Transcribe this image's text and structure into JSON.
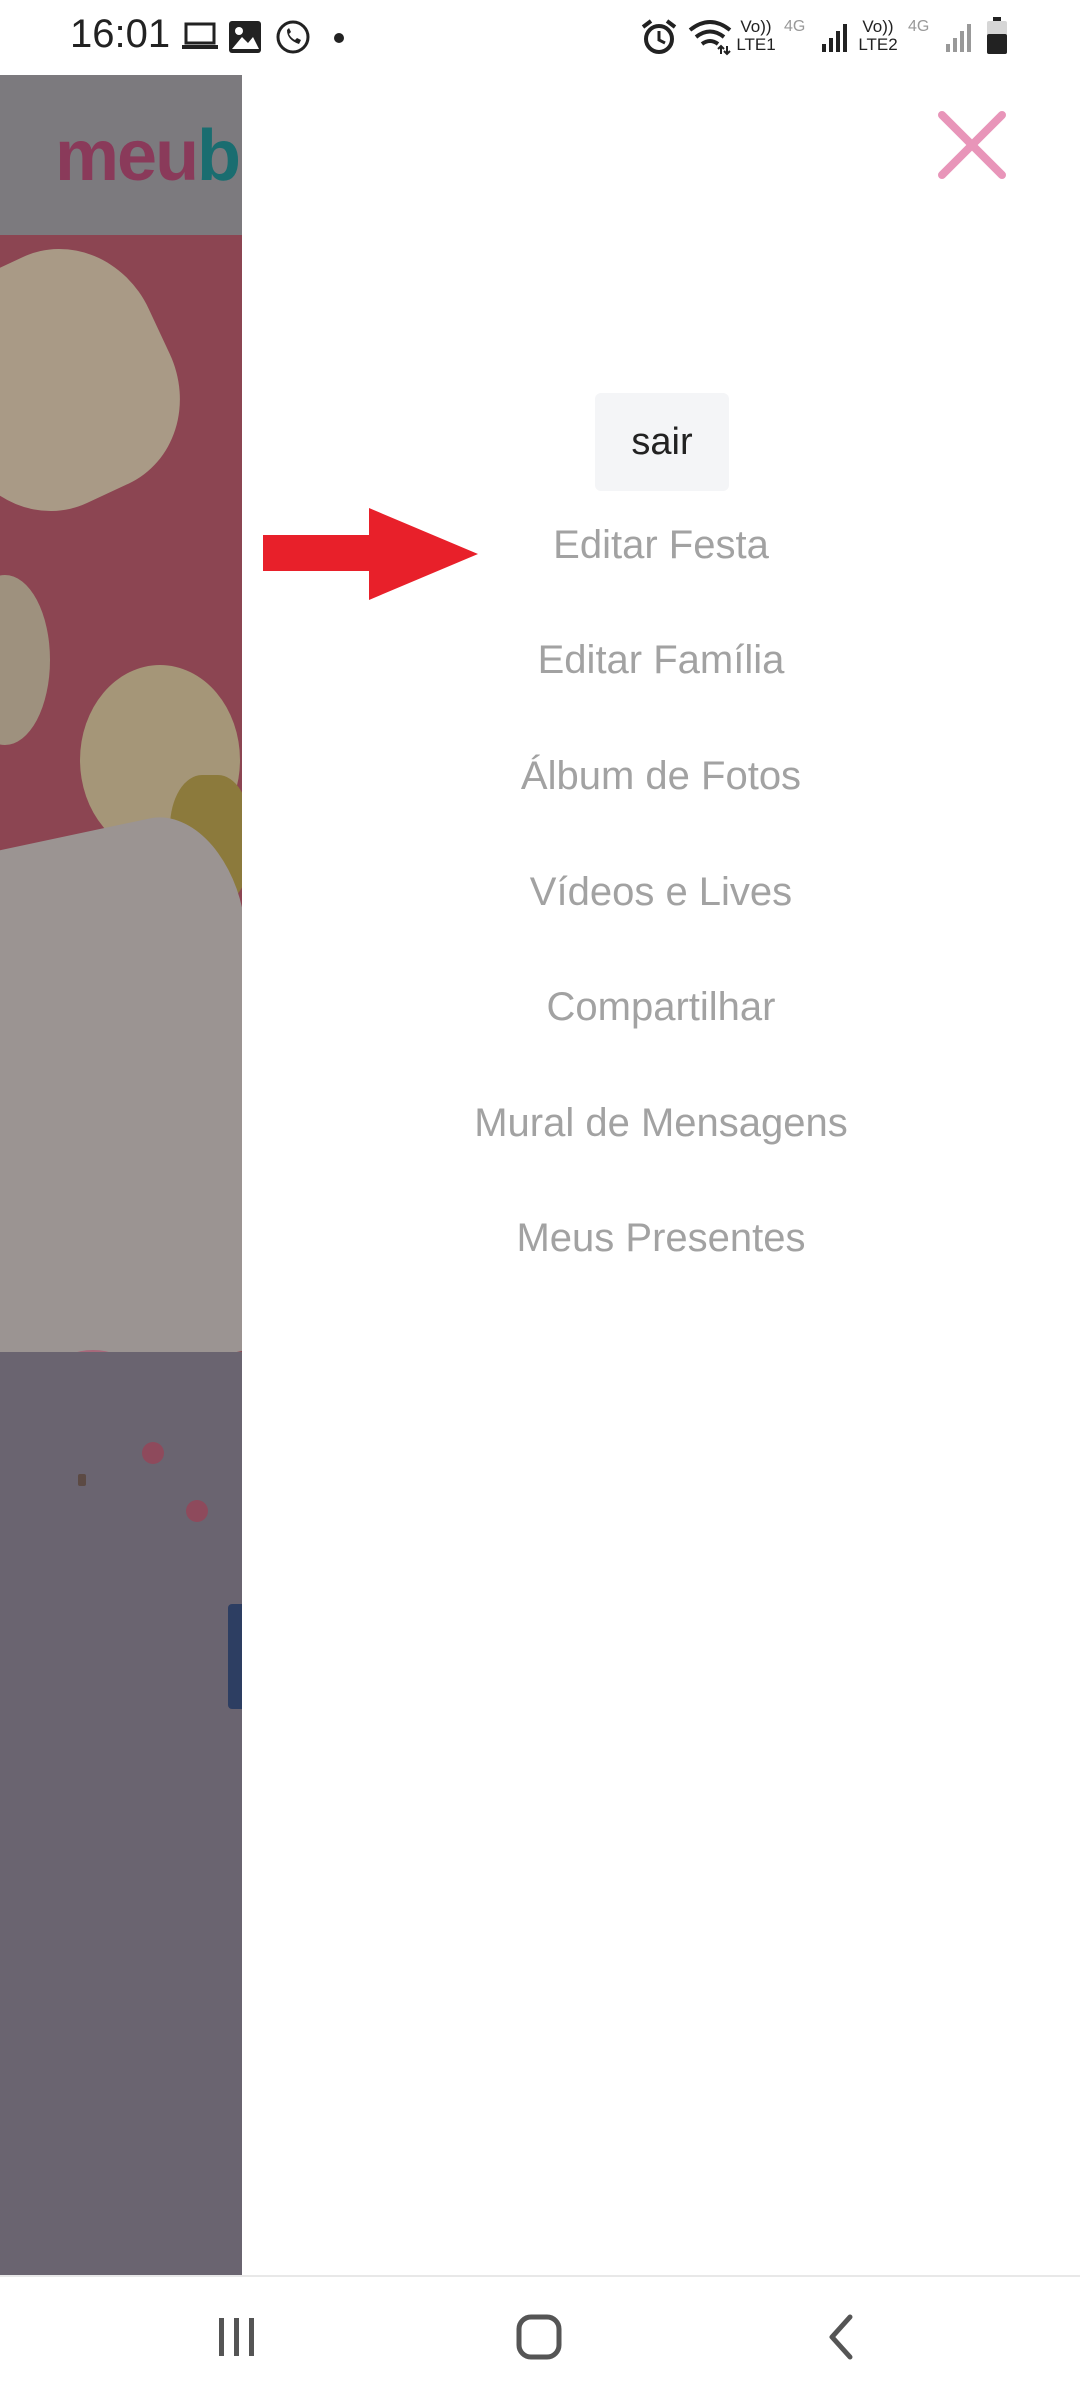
{
  "status_bar": {
    "time": "16:01",
    "left_icons": [
      "laptop-icon",
      "image-icon",
      "whatsapp-icon",
      "dot-icon"
    ],
    "lte1_top": "Vo))",
    "lte1_bottom": "LTE1",
    "sim1_type": "4G",
    "lte2_top": "Vo))",
    "lte2_bottom": "LTE2",
    "sim2_type": "4G"
  },
  "background_app": {
    "logo_part1": "meu",
    "logo_part2": "b"
  },
  "drawer": {
    "close_icon": "close-icon",
    "close_color": "#e895b9",
    "logout_label": "sair",
    "menu_items": [
      "Editar Festa",
      "Editar Família",
      "Álbum de Fotos",
      "Vídeos e Lives",
      "Compartilhar",
      "Mural de Mensagens",
      "Meus Presentes"
    ]
  },
  "annotation": {
    "arrow_color": "#e8202a"
  },
  "nav_bar": {
    "buttons": [
      "recents-icon",
      "home-icon",
      "back-icon"
    ]
  }
}
